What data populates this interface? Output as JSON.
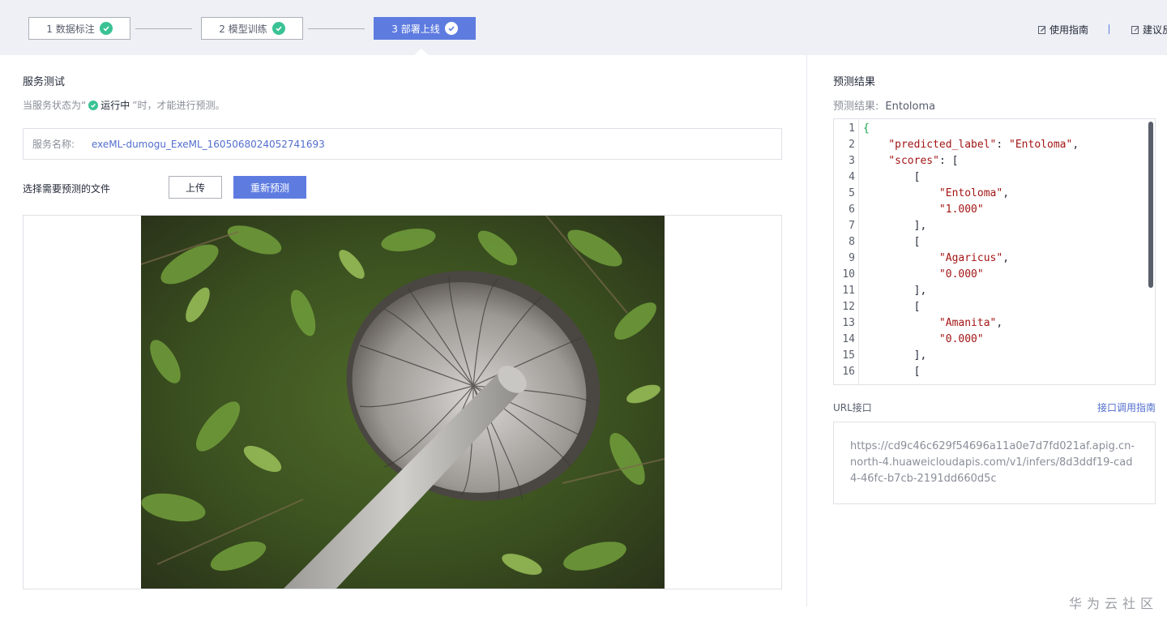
{
  "steps": [
    {
      "label": "1 数据标注",
      "state": "done"
    },
    {
      "label": "2 模型训练",
      "state": "done"
    },
    {
      "label": "3 部署上线",
      "state": "active"
    }
  ],
  "top_links": {
    "guide": "使用指南",
    "feedback": "建议反"
  },
  "left": {
    "title": "服务测试",
    "hint_prefix": "当服务状态为“",
    "hint_status": "运行中",
    "hint_suffix": "”时，才能进行预测。",
    "service_label": "服务名称:",
    "service_name": "exeML-dumogu_ExeML_1605068024052741693",
    "file_label": "选择需要预测的文件",
    "upload_button": "上传",
    "repredict_button": "重新预测"
  },
  "right": {
    "title": "预测结果",
    "result_label": "预测结果:",
    "result_value": "Entoloma",
    "code_lines": [
      {
        "n": "1",
        "text": "{"
      },
      {
        "n": "2",
        "text": "    \"predicted_label\": \"Entoloma\","
      },
      {
        "n": "3",
        "text": "    \"scores\": ["
      },
      {
        "n": "4",
        "text": "        ["
      },
      {
        "n": "5",
        "text": "            \"Entoloma\","
      },
      {
        "n": "6",
        "text": "            \"1.000\""
      },
      {
        "n": "7",
        "text": "        ],"
      },
      {
        "n": "8",
        "text": "        ["
      },
      {
        "n": "9",
        "text": "            \"Agaricus\","
      },
      {
        "n": "10",
        "text": "            \"0.000\""
      },
      {
        "n": "11",
        "text": "        ],"
      },
      {
        "n": "12",
        "text": "        ["
      },
      {
        "n": "13",
        "text": "            \"Amanita\","
      },
      {
        "n": "14",
        "text": "            \"0.000\""
      },
      {
        "n": "15",
        "text": "        ],"
      },
      {
        "n": "16",
        "text": "        ["
      }
    ],
    "url_label": "URL接口",
    "url_guide": "接口调用指南",
    "url_value": "https://cd9c46c629f54696a11a0e7d7fd021af.apig.cn-north-4.huaweicloudapis.com/v1/infers/8d3ddf19-cad4-46fc-b7cb-2191dd660d5c"
  },
  "watermark": "华为云社区",
  "colors": {
    "accent": "#5e7ce0",
    "success": "#3ac295"
  }
}
